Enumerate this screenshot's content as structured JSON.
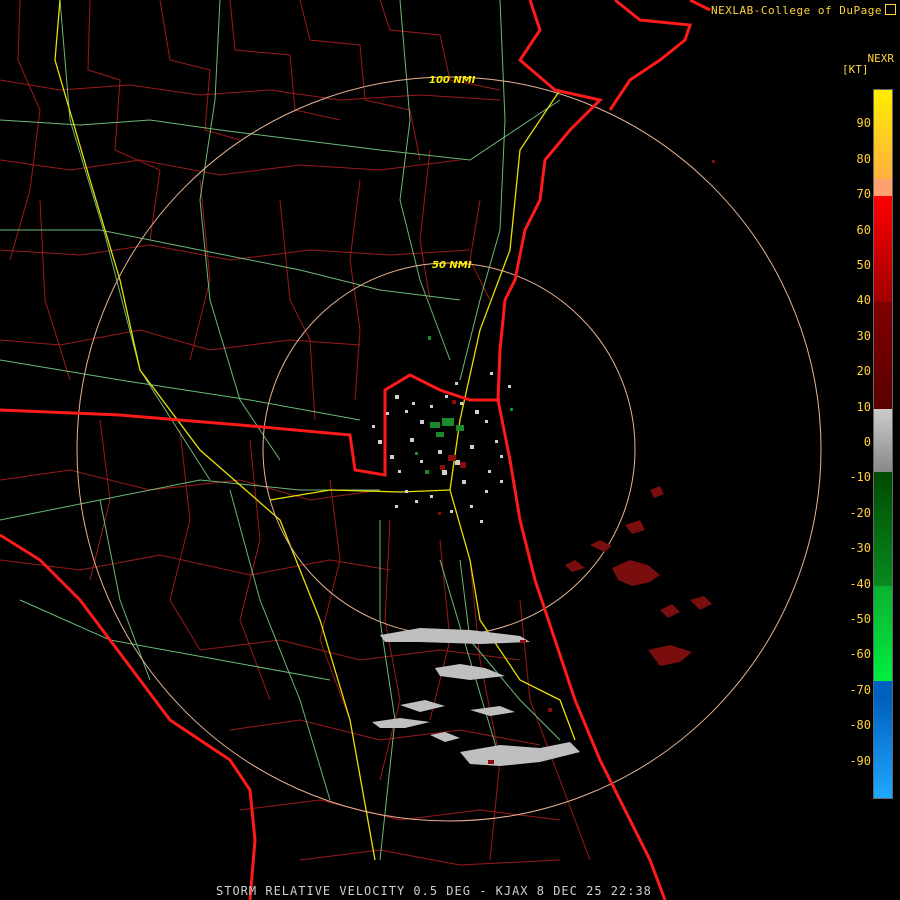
{
  "brand": {
    "text": "NEXLAB-College of DuPage"
  },
  "product": {
    "label": "NEXR"
  },
  "legend": {
    "units": "[KT]",
    "ticks": [
      "90",
      "80",
      "70",
      "60",
      "50",
      "40",
      "30",
      "20",
      "10",
      "0",
      "-10",
      "-20",
      "-30",
      "-40",
      "-50",
      "-60",
      "-70",
      "-80",
      "-90"
    ],
    "colors": {
      "positive_high": "#ffee00",
      "positive_orange": "#ffa070",
      "positive_red": "#ff0000",
      "positive_dark": "#5a0000",
      "zero_gray": "#cccccc",
      "negative_dark": "#004a00",
      "negative_green": "#00ee40",
      "negative_blue": "#0060c0",
      "negative_light": "#20a8ff"
    }
  },
  "rings": [
    {
      "label": "100 NMI"
    },
    {
      "label": "50 NMI"
    }
  ],
  "footer": {
    "text": "STORM RELATIVE VELOCITY 0.5 DEG - KJAX 8 DEC 25 22:38"
  }
}
